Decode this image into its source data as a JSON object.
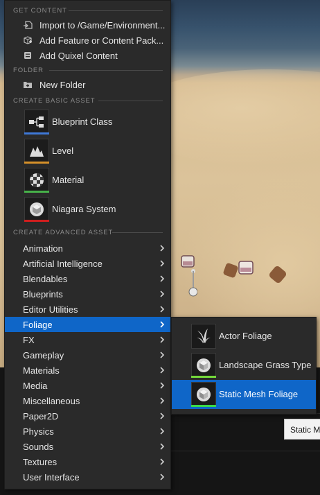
{
  "menu": {
    "sections": {
      "get_content": "GET CONTENT",
      "folder": "FOLDER",
      "basic": "CREATE BASIC ASSET",
      "advanced": "CREATE ADVANCED ASSET"
    },
    "get_content_items": [
      {
        "label": "Import to /Game/Environment...",
        "icon": "import-icon"
      },
      {
        "label": "Add Feature or Content Pack...",
        "icon": "content-pack-icon"
      },
      {
        "label": "Add Quixel Content",
        "icon": "quixel-icon"
      }
    ],
    "folder_items": [
      {
        "label": "New Folder",
        "icon": "new-folder-icon"
      }
    ],
    "basic_assets": [
      {
        "label": "Blueprint Class",
        "icon": "blueprint-class-icon",
        "color": "#3f79d8"
      },
      {
        "label": "Level",
        "icon": "level-icon",
        "color": "#d6912a"
      },
      {
        "label": "Material",
        "icon": "material-icon",
        "color": "#47b24a"
      },
      {
        "label": "Niagara System",
        "icon": "niagara-system-icon",
        "color": "#d01e1e"
      }
    ],
    "advanced_assets": [
      "Animation",
      "Artificial Intelligence",
      "Blendables",
      "Blueprints",
      "Editor Utilities",
      "Foliage",
      "FX",
      "Gameplay",
      "Materials",
      "Media",
      "Miscellaneous",
      "Paper2D",
      "Physics",
      "Sounds",
      "Textures",
      "User Interface"
    ],
    "active_category": "Foliage"
  },
  "submenu": {
    "items": [
      {
        "label": "Actor Foliage",
        "icon": "actor-foliage-icon",
        "color": ""
      },
      {
        "label": "Landscape Grass Type",
        "icon": "landscape-grass-type-icon",
        "color": "#74d83a"
      },
      {
        "label": "Static Mesh Foliage",
        "icon": "static-mesh-foliage-icon",
        "color": "#3ad84a"
      }
    ],
    "active_item": "Static Mesh Foliage"
  },
  "tooltip": {
    "text": "Static M"
  },
  "colors": {
    "highlight": "#0f66c8",
    "menu_bg": "#2a2a2a",
    "section_text": "#8a8a8a"
  }
}
